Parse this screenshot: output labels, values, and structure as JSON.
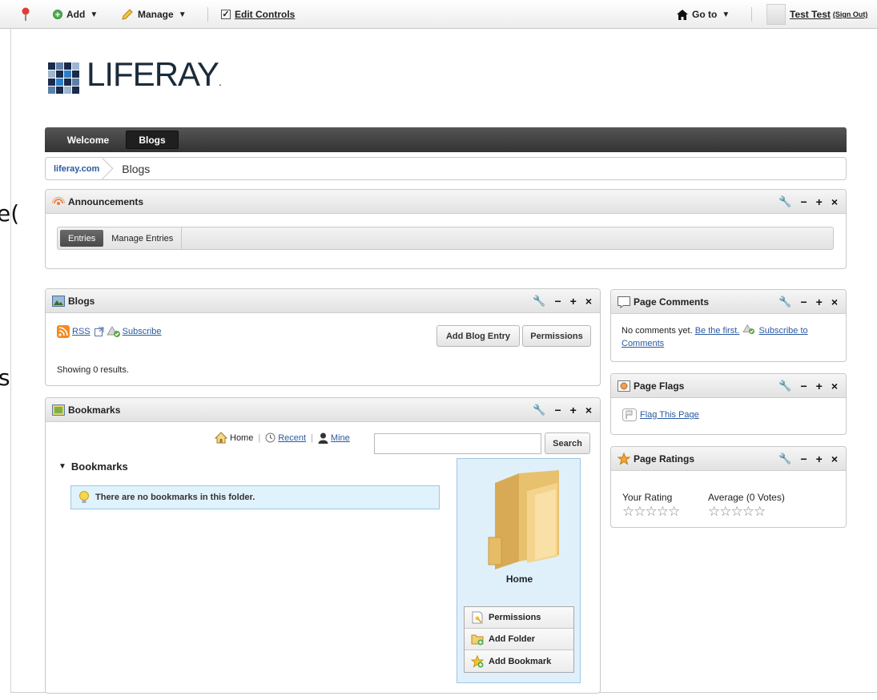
{
  "dockbar": {
    "add": "Add",
    "manage": "Manage",
    "edit_controls": "Edit Controls",
    "goto": "Go to",
    "user": "Test Test",
    "sign_out": "(Sign Out)",
    "caret": "▼"
  },
  "ghost_text": {
    "a": "e(",
    "b": "s"
  },
  "logo": {
    "text": "LIFERAY",
    "dot": "."
  },
  "nav": {
    "tabs": [
      "Welcome",
      "Blogs"
    ],
    "selected": "Blogs"
  },
  "breadcrumb": {
    "site": "liferay.com",
    "page": "Blogs"
  },
  "announcements": {
    "title": "Announcements",
    "tabs": [
      "Entries",
      "Manage Entries"
    ]
  },
  "blogs": {
    "title": "Blogs",
    "rss": "RSS",
    "subscribe": "Subscribe",
    "add_entry": "Add Blog Entry",
    "permissions": "Permissions",
    "results": "Showing 0 results."
  },
  "bookmarks": {
    "title": "Bookmarks",
    "nav_home": "Home",
    "nav_recent": "Recent",
    "nav_mine": "Mine",
    "search_button": "Search",
    "search_value": "",
    "section_title": "Bookmarks",
    "empty_message": "There are no bookmarks in this folder.",
    "folder_name": "Home",
    "actions": [
      "Permissions",
      "Add Folder",
      "Add Bookmark"
    ]
  },
  "page_comments": {
    "title": "Page Comments",
    "text": "No comments yet.",
    "be_first": "Be the first.",
    "subscribe": "Subscribe to Comments"
  },
  "page_flags": {
    "title": "Page Flags",
    "flag_link": "Flag This Page"
  },
  "page_ratings": {
    "title": "Page Ratings",
    "your_rating": "Your Rating",
    "average": "Average (0 Votes)",
    "your_stars": "☆☆☆☆☆",
    "avg_stars": "☆☆☆☆☆"
  },
  "controls": {
    "wrench": "🔧",
    "minus": "−",
    "plus": "+",
    "close": "×"
  },
  "colors": {
    "nav_bg": "#3d3d3d",
    "link": "#2a5aa0",
    "info_bg": "#e0f2fb"
  }
}
